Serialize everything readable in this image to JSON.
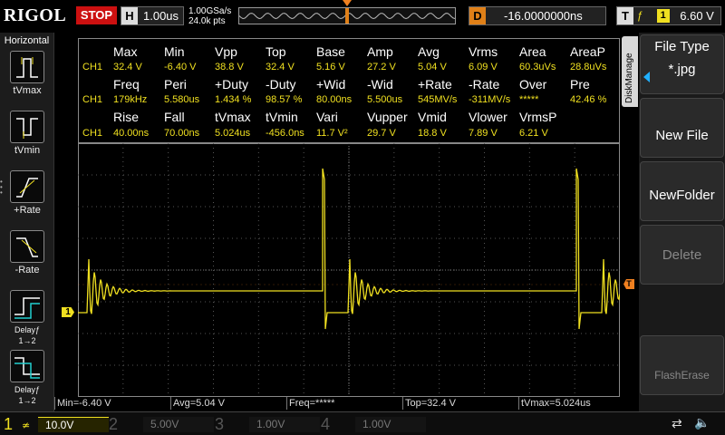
{
  "brand": "RIGOL",
  "run_state": "STOP",
  "timebase": {
    "letter": "H",
    "value": "1.00us"
  },
  "sample_rate": "1.00GSa/s",
  "mem_depth": "24.0k pts",
  "delay": {
    "letter": "D",
    "value": "-16.0000000ns"
  },
  "trigger": {
    "letter": "T",
    "edge_icon": "rising-edge-icon",
    "source": "1",
    "level": "6.60 V"
  },
  "left_panel": {
    "title": "Horizontal",
    "items": [
      "tVmax",
      "tVmin",
      "+Rate",
      "-Rate",
      "Delayƒ\n1→2",
      "Delayƒ\n1→2"
    ]
  },
  "measure": {
    "channel": "CH1",
    "rows": [
      {
        "headers": [
          "Max",
          "Min",
          "Vpp",
          "Top",
          "Base",
          "Amp",
          "Avg",
          "Vrms",
          "Area",
          "AreaP"
        ],
        "values": [
          "32.4 V",
          "-6.40 V",
          "38.8 V",
          "32.4 V",
          "5.16 V",
          "27.2 V",
          "5.04 V",
          "6.09 V",
          "60.3uVs",
          "28.8uVs"
        ]
      },
      {
        "headers": [
          "Freq",
          "Peri",
          "+Duty",
          "-Duty",
          "+Wid",
          "-Wid",
          "+Rate",
          "-Rate",
          "Over",
          "Pre"
        ],
        "values": [
          "179kHz",
          "5.580us",
          "1.434 %",
          "98.57 %",
          "80.00ns",
          "5.500us",
          "545MV/s",
          "-311MV/s",
          "*****",
          "42.46 %"
        ]
      },
      {
        "headers": [
          "Rise",
          "Fall",
          "tVmax",
          "tVmin",
          "Vari",
          "Vupper",
          "Vmid",
          "Vlower",
          "VrmsP",
          ""
        ],
        "values": [
          "40.00ns",
          "70.00ns",
          "5.024us",
          "-456.0ns",
          "11.7 V²",
          "29.7 V",
          "18.8 V",
          "7.89 V",
          "6.21 V",
          ""
        ]
      }
    ]
  },
  "disk_tab": "DiskManage",
  "right_menu": {
    "file_type_title": "File Type",
    "file_type_value": "*.jpg",
    "new_file": "New File",
    "new_folder": "NewFolder",
    "delete": "Delete",
    "flash_erase": "FlashErase"
  },
  "ch1_marker": "1",
  "trig_marker": "T",
  "status": {
    "min": "Min=-6.40 V",
    "avg": "Avg=5.04 V",
    "freq": "Freq=*****",
    "top": "Top=32.4 V",
    "tvmax": "tVmax=5.024us"
  },
  "channels": [
    {
      "num": "1",
      "scale": "10.0V",
      "color": "#f0e020",
      "active": true
    },
    {
      "num": "2",
      "scale": "5.00V",
      "color": "#22d0d0",
      "active": false
    },
    {
      "num": "3",
      "scale": "1.00V",
      "color": "#e020e0",
      "active": false
    },
    {
      "num": "4",
      "scale": "1.00V",
      "color": "#2060f0",
      "active": false
    }
  ],
  "colors": {
    "ch1": "#f0e020",
    "grid": "#555555",
    "trigger": "#f08020",
    "stop": "#cc1010"
  }
}
